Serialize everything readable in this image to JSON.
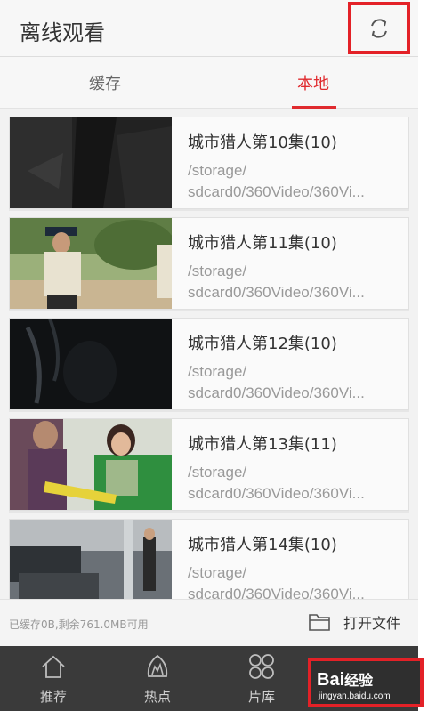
{
  "header": {
    "title": "离线观看",
    "refresh_icon": "refresh-icon"
  },
  "tabs": [
    {
      "label": "缓存",
      "active": false
    },
    {
      "label": "本地",
      "active": true
    }
  ],
  "videos": [
    {
      "name": "城市猎人第10集(10)",
      "path_line1": "/storage/",
      "path_line2": "sdcard0/360Video/360Vi..."
    },
    {
      "name": "城市猎人第11集(10)",
      "path_line1": "/storage/",
      "path_line2": "sdcard0/360Video/360Vi..."
    },
    {
      "name": "城市猎人第12集(10)",
      "path_line1": "/storage/",
      "path_line2": "sdcard0/360Video/360Vi..."
    },
    {
      "name": "城市猎人第13集(11)",
      "path_line1": "/storage/",
      "path_line2": "sdcard0/360Video/360Vi..."
    },
    {
      "name": "城市猎人第14集(10)",
      "path_line1": "/storage/",
      "path_line2": "sdcard0/360Video/360Vi..."
    }
  ],
  "storage": {
    "text": "已缓存0B,剩余761.0MB可用",
    "open_file_label": "打开文件"
  },
  "bottom_nav": [
    {
      "label": "推荐",
      "icon": "home-icon"
    },
    {
      "label": "热点",
      "icon": "flame-icon"
    },
    {
      "label": "片库",
      "icon": "grid-icon"
    }
  ],
  "watermark": {
    "logo": "Bai",
    "logo_suffix": "经验",
    "url": "jingyan.baidu.com"
  },
  "colors": {
    "accent": "#e02b2f",
    "highlight_box": "#e32127",
    "nav_bg": "#3a3a3a"
  }
}
